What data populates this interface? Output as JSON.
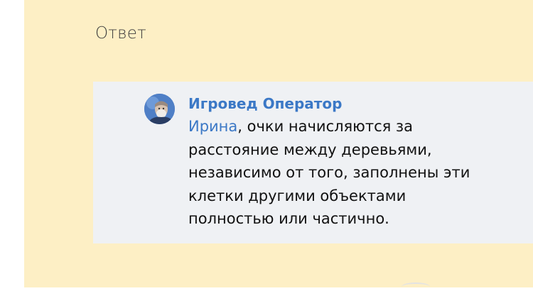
{
  "answer_heading": "Ответ",
  "comment": {
    "author": "Игровед Оператор",
    "mention": "Ирина",
    "text_after_mention": ", очки начисляются за",
    "lines": [
      "расстояние между деревьями,",
      "независимо от того, заполнены эти",
      "клетки другими объектами",
      "полностью или частично."
    ]
  },
  "colors": {
    "panel_background": "#fdefc5",
    "card_background": "#eff1f4",
    "link": "#3b78c6",
    "text": "#111111"
  },
  "icons": {
    "avatar": "user-avatar-icon"
  }
}
